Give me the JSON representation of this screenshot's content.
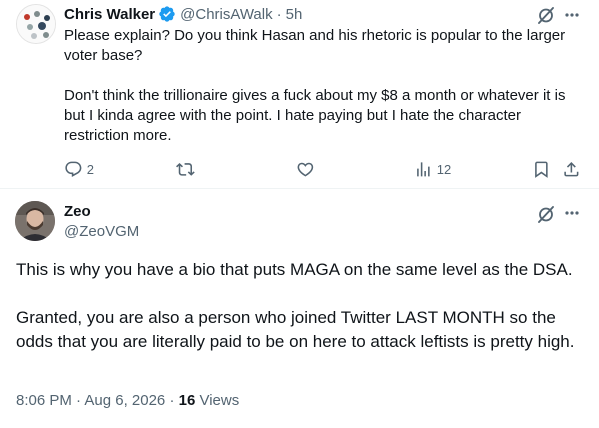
{
  "reply": {
    "author_name": "Chris Walker",
    "author_handle": "@ChrisAWalk",
    "separator": "·",
    "time": "5h",
    "text": "Please explain? Do you think Hasan and his rhetoric is popular to the larger voter base?\n\nDon't think the trillionaire gives a fuck about my $8 a month or whatever it is but I kinda agree with the point. I hate paying but I hate the character restriction more.",
    "replies_count": "2",
    "views_count": "12",
    "verified_color": "#1d9bf0"
  },
  "main_tweet": {
    "author_name": "Zeo",
    "author_handle": "@ZeoVGM",
    "text": "This is why you have a bio that puts MAGA on the same level as the DSA.\n\nGranted, you are also a person who joined Twitter LAST MONTH so the odds that you are literally paid to be on here to attack leftists is pretty high.",
    "timestamp": "8:06 PM · Aug 6, 2026",
    "meta_sep": " · ",
    "views_count": "16",
    "views_label": " Views"
  },
  "colors": {
    "text": "#0f1419",
    "secondary": "#536471",
    "divider": "#eff3f4",
    "accent": "#1d9bf0"
  },
  "icons": {
    "reply": "reply-icon",
    "retweet": "retweet-icon",
    "like": "like-icon",
    "views": "views-icon",
    "bookmark": "bookmark-icon",
    "share": "share-icon",
    "grok": "grok-icon",
    "more": "more-icon",
    "verified": "verified-badge-icon"
  }
}
